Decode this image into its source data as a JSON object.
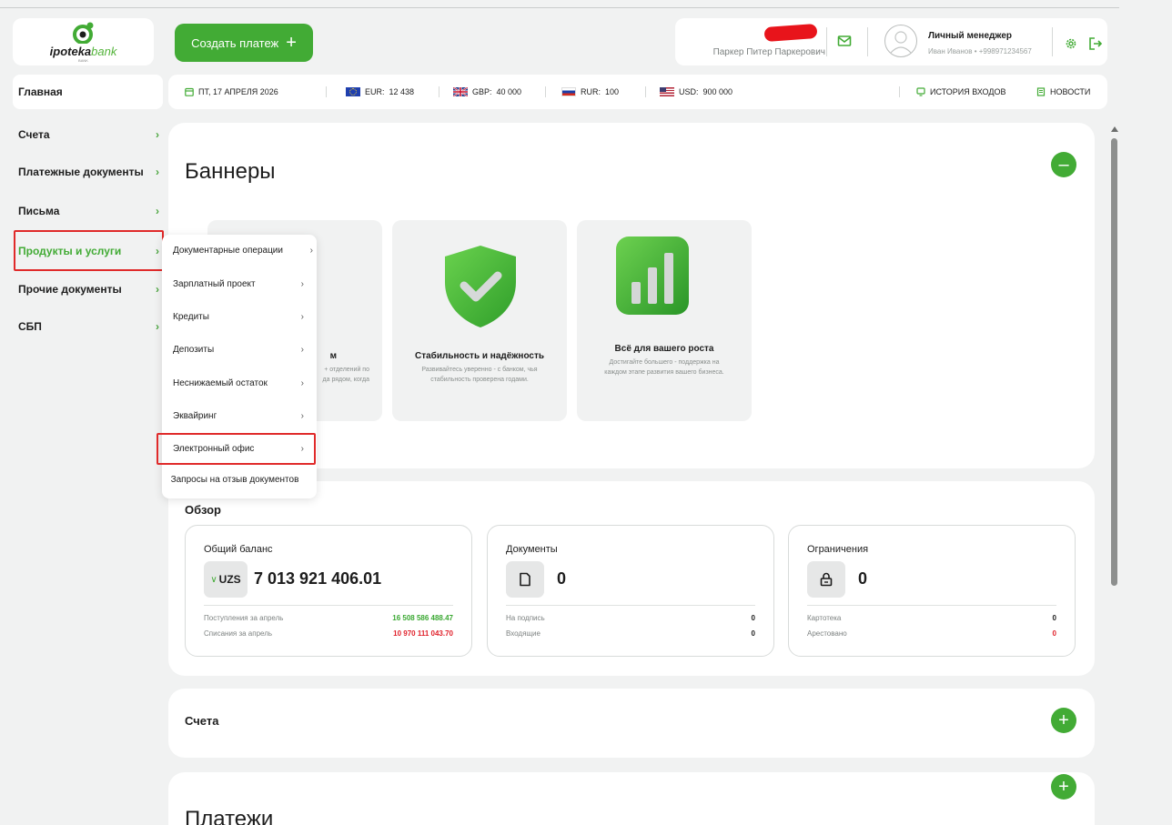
{
  "app": {
    "logo_text_main": "ipoteka",
    "logo_text_accent": "bank",
    "logo_sub": "BANK"
  },
  "header": {
    "create_payment_label": "Создать платеж",
    "user_name": "Паркер Питер Паркерович",
    "manager_title": "Личный менеджер",
    "manager_contact": "Иван Иванов • +998971234567"
  },
  "info_bar": {
    "date": "ПТ, 17 АПРЕЛЯ 2026",
    "currencies": [
      {
        "code": "EUR:",
        "value": "12 438",
        "flag": "eu-flag"
      },
      {
        "code": "GBP:",
        "value": "40 000",
        "flag": "uk-flag"
      },
      {
        "code": "RUR:",
        "value": "100",
        "flag": "ru-flag"
      },
      {
        "code": "USD:",
        "value": "900 000",
        "flag": "us-flag"
      }
    ],
    "login_history": "ИСТОРИЯ ВХОДОВ",
    "news": "НОВОСТИ"
  },
  "sidebar": {
    "items": [
      {
        "label": "Главная"
      },
      {
        "label": "Счета"
      },
      {
        "label": "Платежные документы"
      },
      {
        "label": "Письма"
      },
      {
        "label": "Продукты и услуги"
      },
      {
        "label": "Прочие документы"
      },
      {
        "label": "СБП"
      }
    ]
  },
  "dropdown": {
    "items": [
      {
        "label": "Документарные операции"
      },
      {
        "label": "Зарплатный проект"
      },
      {
        "label": "Кредиты"
      },
      {
        "label": "Депозиты"
      },
      {
        "label": "Неснижаемый остаток"
      },
      {
        "label": "Эквайринг"
      },
      {
        "label": "Электронный офис"
      },
      {
        "label": "Запросы на отзыв документов"
      }
    ]
  },
  "banners": {
    "title": "Баннеры",
    "cards": [
      {
        "title": "м",
        "desc_line1": "+ отделений по",
        "desc_line2": "да рядом, когда"
      },
      {
        "title": "Стабильность и надёжность",
        "desc_line1": "Развивайтесь уверенно - с банком, чья",
        "desc_line2": "стабильность проверена годами."
      },
      {
        "title": "Всё для вашего роста",
        "desc_line1": "Достигайте большего - поддержка на",
        "desc_line2": "каждом этапе развития вашего бизнеса."
      }
    ]
  },
  "overview": {
    "title": "Обзор",
    "balance": {
      "title": "Общий баланс",
      "currency": "UZS",
      "value": "7 013 921 406.01",
      "row1_label": "Поступления за апрель",
      "row1_value": "16 508 586 488.47",
      "row2_label": "Списания за апрель",
      "row2_value": "10 970 111 043.70"
    },
    "documents": {
      "title": "Документы",
      "value": "0",
      "row1_label": "На подпись",
      "row1_value": "0",
      "row2_label": "Входящие",
      "row2_value": "0"
    },
    "restrictions": {
      "title": "Ограничения",
      "value": "0",
      "row1_label": "Картотека",
      "row1_value": "0",
      "row2_label": "Арестовано",
      "row2_value": "0"
    }
  },
  "accounts": {
    "title": "Счета"
  },
  "payments": {
    "title": "Платежи"
  },
  "colors": {
    "accent": "#42ab35",
    "income": "#3aa832",
    "expense": "#e0202a",
    "highlight": "#e02a2a"
  }
}
